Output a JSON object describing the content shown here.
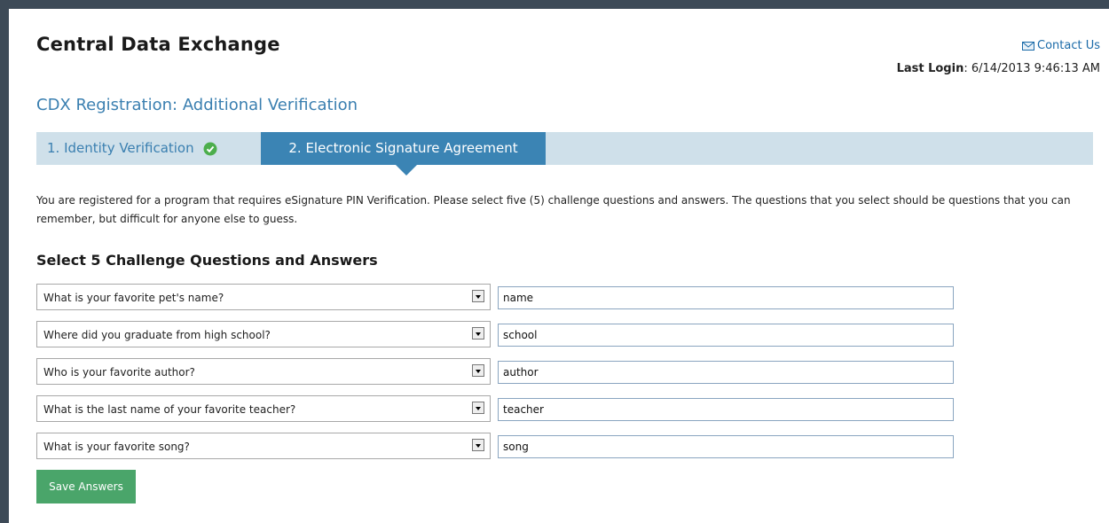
{
  "header": {
    "app_title": "Central Data Exchange",
    "contact_label": "Contact Us",
    "last_login_label": "Last Login",
    "last_login_value": ": 6/14/2013 9:46:13 AM"
  },
  "section_title": "CDX Registration: Additional Verification",
  "tabs": [
    {
      "label": "1. Identity Verification",
      "status": "complete"
    },
    {
      "label": "2. Electronic Signature Agreement",
      "status": "active"
    }
  ],
  "intro_text": "You are registered for a program that requires eSignature PIN Verification. Please select five (5) challenge questions and answers. The questions that you select should be questions that you can remember, but difficult for anyone else to guess.",
  "qa_heading": "Select 5 Challenge Questions and Answers",
  "questions": [
    {
      "question": "What is your favorite pet's name?",
      "answer": "name"
    },
    {
      "question": "Where did you graduate from high school?",
      "answer": "school"
    },
    {
      "question": "Who is your favorite author?",
      "answer": "author"
    },
    {
      "question": "What is the last name of your favorite teacher?",
      "answer": "teacher"
    },
    {
      "question": "What is your favorite song?",
      "answer": "song"
    }
  ],
  "save_label": "Save Answers",
  "colors": {
    "accent": "#3b84b4",
    "tabbar": "#cfe0ea",
    "save": "#4aa56a",
    "check": "#4cae4c"
  },
  "icons": {
    "contact": "mail-icon",
    "step_complete": "check-circle-icon",
    "dropdown": "chevron-down-icon"
  }
}
